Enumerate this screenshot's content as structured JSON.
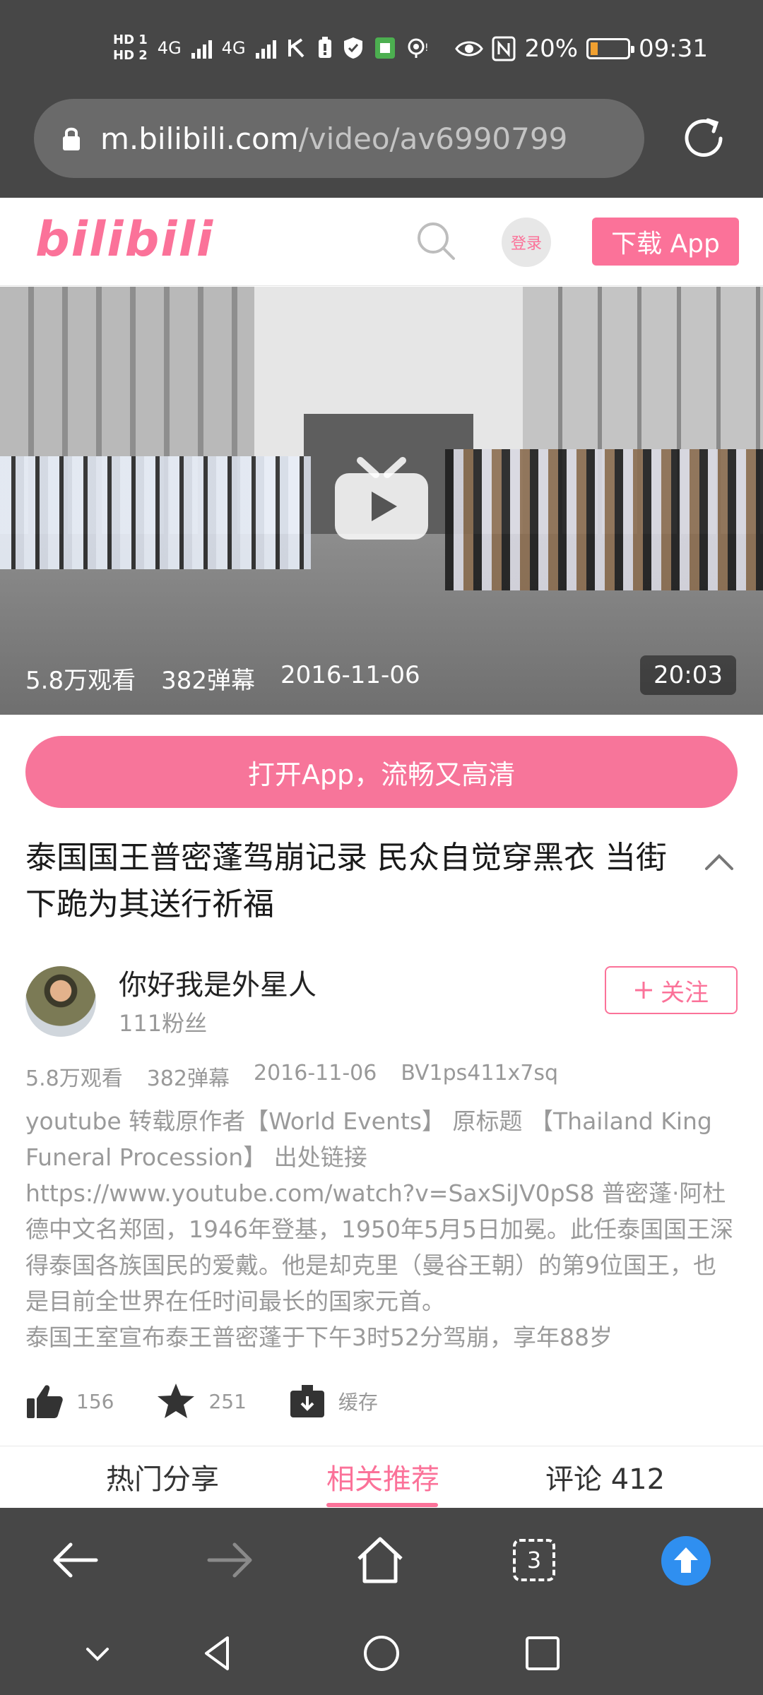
{
  "status_bar": {
    "hd1": "HD 1",
    "hd2": "HD 2",
    "net1": "4G",
    "net2": "4G",
    "battery_percent": "20%",
    "battery_level": 0.2,
    "time": "09:31"
  },
  "address_bar": {
    "domain": "m.bilibili.com",
    "path": "/video/av6990799"
  },
  "header": {
    "logo": "bilibili",
    "login_label": "登录",
    "download_label": "下载 App"
  },
  "video": {
    "views": "5.8万观看",
    "danmaku": "382弹幕",
    "date": "2016-11-06",
    "duration": "20:03"
  },
  "open_app_label": "打开App，流畅又高清",
  "title": "泰国国王普密蓬驾崩记录 民众自觉穿黑衣 当街下跪为其送行祈福",
  "uploader": {
    "name": "你好我是外星人",
    "fans": "111粉丝",
    "follow_label": "关注"
  },
  "stats": {
    "views": "5.8万观看",
    "danmaku": "382弹幕",
    "date": "2016-11-06",
    "bvid": "BV1ps411x7sq"
  },
  "description": {
    "p1": "youtube 转载原作者【World Events】 原标题 【Thailand King Funeral Procession】 出处链接 https://www.youtube.com/watch?v=SaxSiJV0pS8 普密蓬·阿杜德中文名郑固，1946年登基，1950年5月5日加冕。此任泰国国王深得泰国各族国民的爱戴。他是却克里（曼谷王朝）的第9位国王，也是目前全世界在任时间最长的国家元首。",
    "p2": "泰国王室宣布泰王普密蓬于下午3时52分驾崩，享年88岁"
  },
  "actions": {
    "like_count": "156",
    "favorite_count": "251",
    "cache_label": "缓存"
  },
  "tabs": {
    "hot_share": "热门分享",
    "related": "相关推荐",
    "comments": "评论 412"
  },
  "toolbar": {
    "tab_count": "3"
  },
  "colors": {
    "brand_pink": "#fb7299",
    "system_bar": "#474747",
    "scroll_top_blue": "#2f8ff0"
  }
}
